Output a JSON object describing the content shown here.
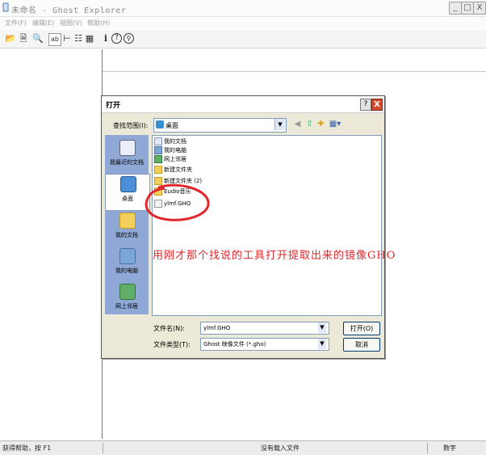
{
  "window": {
    "title": "未命名 - Ghost Explorer",
    "min": "_",
    "max": "□",
    "close": "X"
  },
  "menu": [
    "文件(F)",
    "编辑(E)",
    "视图(V)",
    "帮助(H)"
  ],
  "toolbar": {
    "icons": [
      "open-folder-icon",
      "save-icon",
      "find-icon",
      "rename-icon",
      "tree-view-icon",
      "list-view-icon",
      "details-view-icon",
      "info-icon",
      "help-icon",
      "whats-this-icon"
    ],
    "glyphs": [
      "📂",
      "🗎",
      "🔍",
      "ab",
      "⊢",
      "☷",
      "▦",
      "i",
      "?",
      "⚲"
    ]
  },
  "status": {
    "help": "获得帮助，按 F1",
    "middle": "没有载入文件",
    "right": "数字"
  },
  "dialog": {
    "title": "打开",
    "help": "?",
    "close": "X",
    "lookin_label": "查找范围(I):",
    "lookin_value": "桌面",
    "places": [
      "我最近的文档",
      "桌面",
      "我的文档",
      "我的电脑",
      "网上邻居"
    ],
    "files": [
      {
        "name": "我的文档",
        "type": "doc"
      },
      {
        "name": "我的电脑",
        "type": "pc"
      },
      {
        "name": "网上邻居",
        "type": "net"
      },
      {
        "name": "新建文件夹",
        "type": "folder"
      },
      {
        "name": "新建文件夹 (2)",
        "type": "folder"
      },
      {
        "name": "Eudio音乐",
        "type": "folder"
      },
      {
        "name": "ylmf.GHO",
        "type": "gho"
      }
    ],
    "filename_label": "文件名(N):",
    "filename_value": "ylmf.GHO",
    "filetype_label": "文件类型(T):",
    "filetype_value": "Ghost 映像文件 (*.gho)",
    "open_button": "打开(O)",
    "cancel_button": "取消"
  },
  "annotation": "用刚才那个找说的工具打开提取出来的镜像GHO",
  "colors": {
    "annotation": "#e0262a",
    "places_bar": "#8fa8d6",
    "dialog_bg": "#ece9d8"
  }
}
